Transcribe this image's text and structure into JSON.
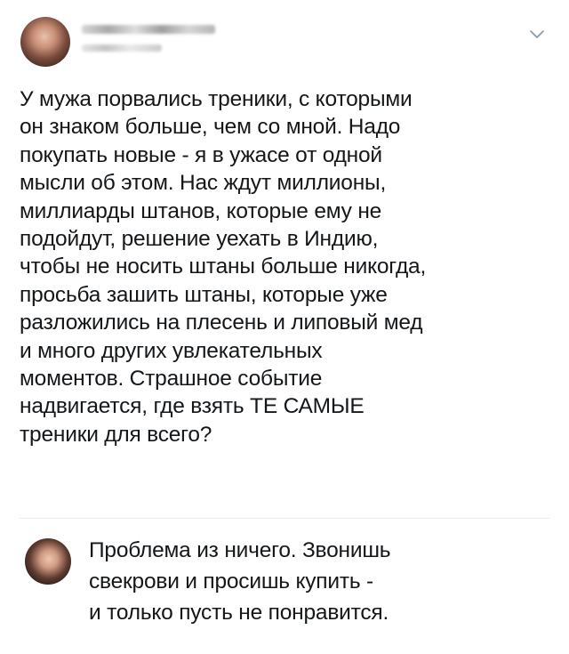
{
  "post": {
    "text_lines": [
      "У мужа порвались треники, с которыми",
      "он знаком больше, чем со мной. Надо",
      "покупать новые - я в ужасе от одной",
      "мысли об этом. Нас ждут миллионы,",
      "миллиарды штанов, которые ему не",
      "подойдут, решение уехать в Индию,",
      "чтобы не носить штаны больше никогда,",
      "просьба зашить штаны, которые уже",
      "разложились на плесень и липовый мед",
      "и много других увлекательных",
      "моментов. Страшное событие",
      "надвигается, где взять ТЕ САМЫЕ",
      "треники для всего?"
    ],
    "menu_icon": "chevron-down-icon",
    "colors": {
      "text": "#14171a",
      "chevron": "#8899a6",
      "divider": "#e6ecf0"
    }
  },
  "reply": {
    "text_lines": [
      "Проблема из ничего. Звонишь",
      "свекрови и просишь купить -",
      "и только пусть не понравится."
    ]
  }
}
